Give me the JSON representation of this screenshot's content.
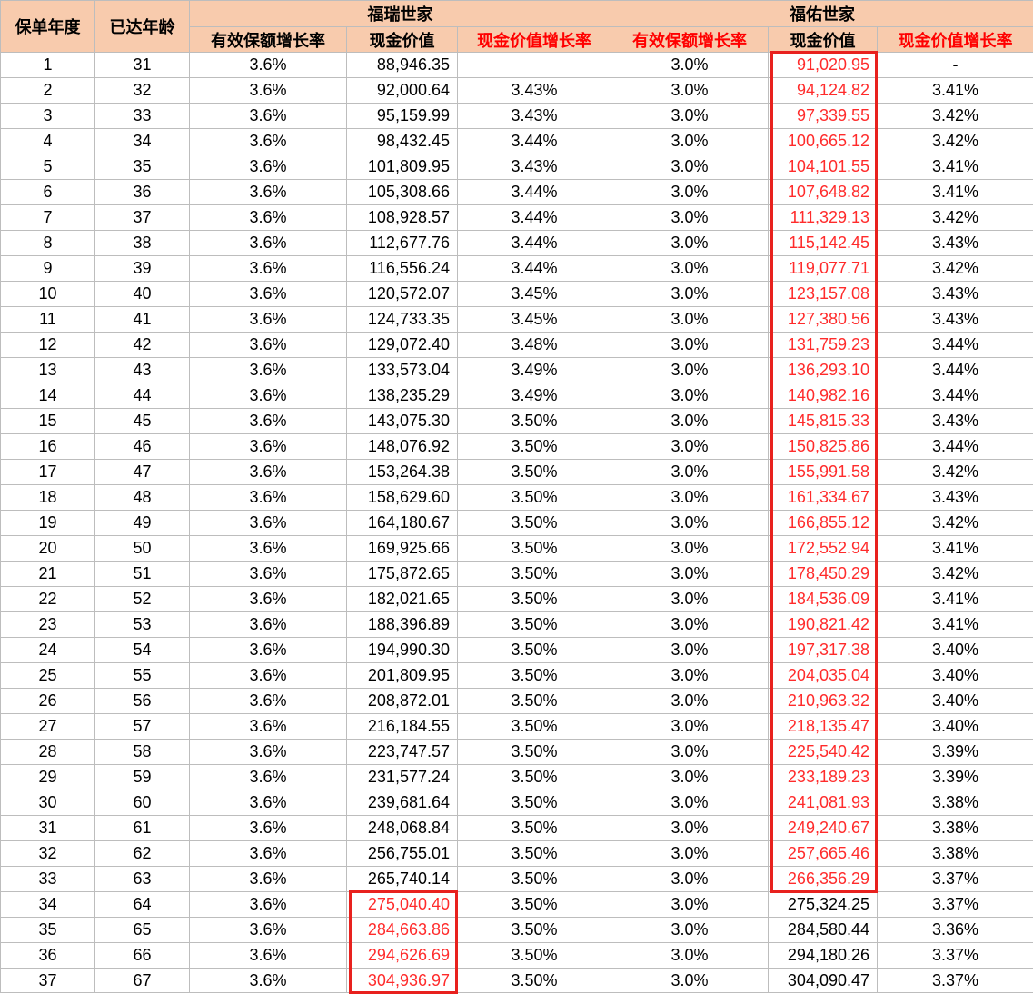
{
  "headers": {
    "policy_year": "保单年度",
    "age": "已达年龄",
    "group_a": "福瑞世家",
    "group_b": "福佑世家",
    "sum_growth": "有效保额增长率",
    "cash_value": "现金价值",
    "cash_growth": "现金价值增长率"
  },
  "rows": [
    {
      "year": "1",
      "age": "31",
      "a_rate": "3.6%",
      "a_cv": "88,946.35",
      "a_cvr": "",
      "b_rate": "3.0%",
      "b_cv": "91,020.95",
      "b_cvr": "-"
    },
    {
      "year": "2",
      "age": "32",
      "a_rate": "3.6%",
      "a_cv": "92,000.64",
      "a_cvr": "3.43%",
      "b_rate": "3.0%",
      "b_cv": "94,124.82",
      "b_cvr": "3.41%"
    },
    {
      "year": "3",
      "age": "33",
      "a_rate": "3.6%",
      "a_cv": "95,159.99",
      "a_cvr": "3.43%",
      "b_rate": "3.0%",
      "b_cv": "97,339.55",
      "b_cvr": "3.42%"
    },
    {
      "year": "4",
      "age": "34",
      "a_rate": "3.6%",
      "a_cv": "98,432.45",
      "a_cvr": "3.44%",
      "b_rate": "3.0%",
      "b_cv": "100,665.12",
      "b_cvr": "3.42%"
    },
    {
      "year": "5",
      "age": "35",
      "a_rate": "3.6%",
      "a_cv": "101,809.95",
      "a_cvr": "3.43%",
      "b_rate": "3.0%",
      "b_cv": "104,101.55",
      "b_cvr": "3.41%"
    },
    {
      "year": "6",
      "age": "36",
      "a_rate": "3.6%",
      "a_cv": "105,308.66",
      "a_cvr": "3.44%",
      "b_rate": "3.0%",
      "b_cv": "107,648.82",
      "b_cvr": "3.41%"
    },
    {
      "year": "7",
      "age": "37",
      "a_rate": "3.6%",
      "a_cv": "108,928.57",
      "a_cvr": "3.44%",
      "b_rate": "3.0%",
      "b_cv": "111,329.13",
      "b_cvr": "3.42%"
    },
    {
      "year": "8",
      "age": "38",
      "a_rate": "3.6%",
      "a_cv": "112,677.76",
      "a_cvr": "3.44%",
      "b_rate": "3.0%",
      "b_cv": "115,142.45",
      "b_cvr": "3.43%"
    },
    {
      "year": "9",
      "age": "39",
      "a_rate": "3.6%",
      "a_cv": "116,556.24",
      "a_cvr": "3.44%",
      "b_rate": "3.0%",
      "b_cv": "119,077.71",
      "b_cvr": "3.42%"
    },
    {
      "year": "10",
      "age": "40",
      "a_rate": "3.6%",
      "a_cv": "120,572.07",
      "a_cvr": "3.45%",
      "b_rate": "3.0%",
      "b_cv": "123,157.08",
      "b_cvr": "3.43%"
    },
    {
      "year": "11",
      "age": "41",
      "a_rate": "3.6%",
      "a_cv": "124,733.35",
      "a_cvr": "3.45%",
      "b_rate": "3.0%",
      "b_cv": "127,380.56",
      "b_cvr": "3.43%"
    },
    {
      "year": "12",
      "age": "42",
      "a_rate": "3.6%",
      "a_cv": "129,072.40",
      "a_cvr": "3.48%",
      "b_rate": "3.0%",
      "b_cv": "131,759.23",
      "b_cvr": "3.44%"
    },
    {
      "year": "13",
      "age": "43",
      "a_rate": "3.6%",
      "a_cv": "133,573.04",
      "a_cvr": "3.49%",
      "b_rate": "3.0%",
      "b_cv": "136,293.10",
      "b_cvr": "3.44%"
    },
    {
      "year": "14",
      "age": "44",
      "a_rate": "3.6%",
      "a_cv": "138,235.29",
      "a_cvr": "3.49%",
      "b_rate": "3.0%",
      "b_cv": "140,982.16",
      "b_cvr": "3.44%"
    },
    {
      "year": "15",
      "age": "45",
      "a_rate": "3.6%",
      "a_cv": "143,075.30",
      "a_cvr": "3.50%",
      "b_rate": "3.0%",
      "b_cv": "145,815.33",
      "b_cvr": "3.43%"
    },
    {
      "year": "16",
      "age": "46",
      "a_rate": "3.6%",
      "a_cv": "148,076.92",
      "a_cvr": "3.50%",
      "b_rate": "3.0%",
      "b_cv": "150,825.86",
      "b_cvr": "3.44%"
    },
    {
      "year": "17",
      "age": "47",
      "a_rate": "3.6%",
      "a_cv": "153,264.38",
      "a_cvr": "3.50%",
      "b_rate": "3.0%",
      "b_cv": "155,991.58",
      "b_cvr": "3.42%"
    },
    {
      "year": "18",
      "age": "48",
      "a_rate": "3.6%",
      "a_cv": "158,629.60",
      "a_cvr": "3.50%",
      "b_rate": "3.0%",
      "b_cv": "161,334.67",
      "b_cvr": "3.43%"
    },
    {
      "year": "19",
      "age": "49",
      "a_rate": "3.6%",
      "a_cv": "164,180.67",
      "a_cvr": "3.50%",
      "b_rate": "3.0%",
      "b_cv": "166,855.12",
      "b_cvr": "3.42%"
    },
    {
      "year": "20",
      "age": "50",
      "a_rate": "3.6%",
      "a_cv": "169,925.66",
      "a_cvr": "3.50%",
      "b_rate": "3.0%",
      "b_cv": "172,552.94",
      "b_cvr": "3.41%"
    },
    {
      "year": "21",
      "age": "51",
      "a_rate": "3.6%",
      "a_cv": "175,872.65",
      "a_cvr": "3.50%",
      "b_rate": "3.0%",
      "b_cv": "178,450.29",
      "b_cvr": "3.42%"
    },
    {
      "year": "22",
      "age": "52",
      "a_rate": "3.6%",
      "a_cv": "182,021.65",
      "a_cvr": "3.50%",
      "b_rate": "3.0%",
      "b_cv": "184,536.09",
      "b_cvr": "3.41%"
    },
    {
      "year": "23",
      "age": "53",
      "a_rate": "3.6%",
      "a_cv": "188,396.89",
      "a_cvr": "3.50%",
      "b_rate": "3.0%",
      "b_cv": "190,821.42",
      "b_cvr": "3.41%"
    },
    {
      "year": "24",
      "age": "54",
      "a_rate": "3.6%",
      "a_cv": "194,990.30",
      "a_cvr": "3.50%",
      "b_rate": "3.0%",
      "b_cv": "197,317.38",
      "b_cvr": "3.40%"
    },
    {
      "year": "25",
      "age": "55",
      "a_rate": "3.6%",
      "a_cv": "201,809.95",
      "a_cvr": "3.50%",
      "b_rate": "3.0%",
      "b_cv": "204,035.04",
      "b_cvr": "3.40%"
    },
    {
      "year": "26",
      "age": "56",
      "a_rate": "3.6%",
      "a_cv": "208,872.01",
      "a_cvr": "3.50%",
      "b_rate": "3.0%",
      "b_cv": "210,963.32",
      "b_cvr": "3.40%"
    },
    {
      "year": "27",
      "age": "57",
      "a_rate": "3.6%",
      "a_cv": "216,184.55",
      "a_cvr": "3.50%",
      "b_rate": "3.0%",
      "b_cv": "218,135.47",
      "b_cvr": "3.40%"
    },
    {
      "year": "28",
      "age": "58",
      "a_rate": "3.6%",
      "a_cv": "223,747.57",
      "a_cvr": "3.50%",
      "b_rate": "3.0%",
      "b_cv": "225,540.42",
      "b_cvr": "3.39%"
    },
    {
      "year": "29",
      "age": "59",
      "a_rate": "3.6%",
      "a_cv": "231,577.24",
      "a_cvr": "3.50%",
      "b_rate": "3.0%",
      "b_cv": "233,189.23",
      "b_cvr": "3.39%"
    },
    {
      "year": "30",
      "age": "60",
      "a_rate": "3.6%",
      "a_cv": "239,681.64",
      "a_cvr": "3.50%",
      "b_rate": "3.0%",
      "b_cv": "241,081.93",
      "b_cvr": "3.38%"
    },
    {
      "year": "31",
      "age": "61",
      "a_rate": "3.6%",
      "a_cv": "248,068.84",
      "a_cvr": "3.50%",
      "b_rate": "3.0%",
      "b_cv": "249,240.67",
      "b_cvr": "3.38%"
    },
    {
      "year": "32",
      "age": "62",
      "a_rate": "3.6%",
      "a_cv": "256,755.01",
      "a_cvr": "3.50%",
      "b_rate": "3.0%",
      "b_cv": "257,665.46",
      "b_cvr": "3.38%"
    },
    {
      "year": "33",
      "age": "63",
      "a_rate": "3.6%",
      "a_cv": "265,740.14",
      "a_cvr": "3.50%",
      "b_rate": "3.0%",
      "b_cv": "266,356.29",
      "b_cvr": "3.37%"
    },
    {
      "year": "34",
      "age": "64",
      "a_rate": "3.6%",
      "a_cv": "275,040.40",
      "a_cvr": "3.50%",
      "b_rate": "3.0%",
      "b_cv": "275,324.25",
      "b_cvr": "3.37%"
    },
    {
      "year": "35",
      "age": "65",
      "a_rate": "3.6%",
      "a_cv": "284,663.86",
      "a_cvr": "3.50%",
      "b_rate": "3.0%",
      "b_cv": "284,580.44",
      "b_cvr": "3.36%"
    },
    {
      "year": "36",
      "age": "66",
      "a_rate": "3.6%",
      "a_cv": "294,626.69",
      "a_cvr": "3.50%",
      "b_rate": "3.0%",
      "b_cv": "294,180.26",
      "b_cvr": "3.37%"
    },
    {
      "year": "37",
      "age": "67",
      "a_rate": "3.6%",
      "a_cv": "304,936.97",
      "a_cvr": "3.50%",
      "b_rate": "3.0%",
      "b_cv": "304,090.47",
      "b_cvr": "3.37%"
    }
  ],
  "highlights": {
    "group_b_cash_value_rows": [
      "1",
      "33"
    ],
    "group_a_cash_value_rows": [
      "34",
      "37"
    ]
  },
  "colors": {
    "header_bg": "#f8cbad",
    "header_red_text": "#ff0000",
    "highlight_text": "#ff2b2b",
    "highlight_border": "#e8211e",
    "grid_line": "#bdbdbd"
  }
}
